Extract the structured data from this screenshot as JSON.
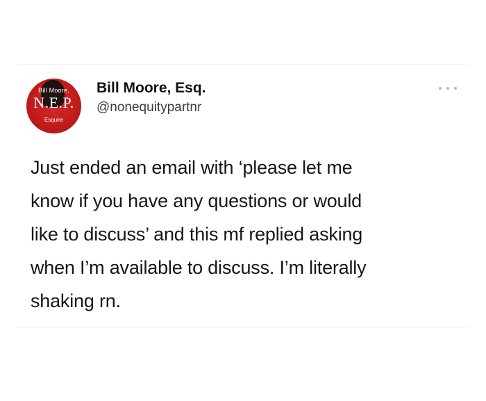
{
  "author": {
    "name": "Bill Moore, Esq.",
    "handle": "@nonequitypartnr"
  },
  "avatar": {
    "top_text": "Bill Moore,",
    "main_text": "N.E.P.",
    "bottom_text": "Esquire"
  },
  "tweet": {
    "lines": [
      "Just ended an email with ‘please let me",
      "know if you have any questions or would",
      "like to discuss’ and this mf replied asking",
      "when I’m available to discuss. I’m literally",
      "shaking rn."
    ]
  },
  "icons": {
    "more": "more-horizontal-icon"
  },
  "colors": {
    "avatar_red": "#c11c1c",
    "text": "#161616",
    "muted": "#b8b8b8"
  }
}
